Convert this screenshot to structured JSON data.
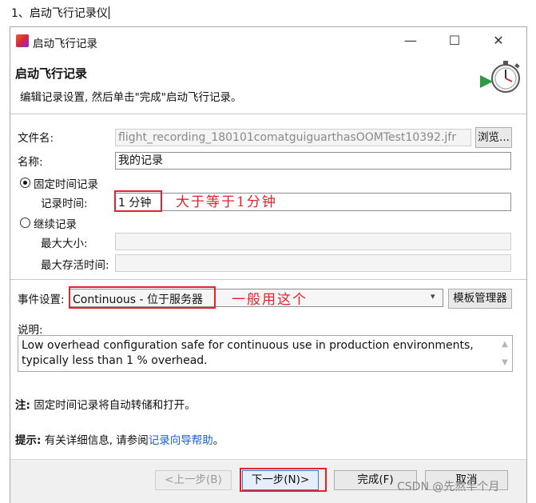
{
  "doc_heading": "1、启动飞行记录仪",
  "window": {
    "title": "启动飞行记录",
    "minimize_glyph": "—",
    "maximize_glyph": "☐",
    "close_glyph": "✕"
  },
  "header": {
    "title": "启动飞行记录",
    "description": "编辑记录设置, 然后单击\"完成\"启动飞行记录。",
    "wizard_icon": "stopwatch-flight-icon"
  },
  "form": {
    "filename_label": "文件名:",
    "filename_value": "flight_recording_180101comatguiguarthasOOMTest10392.jfr",
    "browse_label": "浏览...",
    "name_label": "名称:",
    "name_value": "我的记录",
    "fixed_time_label": "固定时间记录",
    "record_time_label": "记录时间:",
    "record_time_value": "1 分钟",
    "continuous_label": "继续记录",
    "max_size_label": "最大大小:",
    "max_age_label": "最大存活时间:",
    "event_settings_label": "事件设置:",
    "event_settings_value": "Continuous - 位于服务器",
    "template_manager_label": "模板管理器",
    "description_label": "说明:",
    "description_text": "Low overhead configuration safe for continuous use in production environments, typically less than 1 % overhead."
  },
  "annotations": {
    "record_time_note": "大于等于1分钟",
    "event_settings_note": "一般用这个",
    "color": "#e0242d"
  },
  "notes": {
    "note_prefix": "注:",
    "note_text": "固定时间记录将自动转储和打开。",
    "tip_prefix": "提示:",
    "tip_text": "有关详细信息, 请参阅",
    "tip_link": "记录向导帮助",
    "tip_end": "。"
  },
  "buttons": {
    "back": "<上一步(B)",
    "next": "下一步(N)>",
    "finish": "完成(F)",
    "cancel": "取消"
  },
  "watermark": "CSDN @先熬半个月"
}
